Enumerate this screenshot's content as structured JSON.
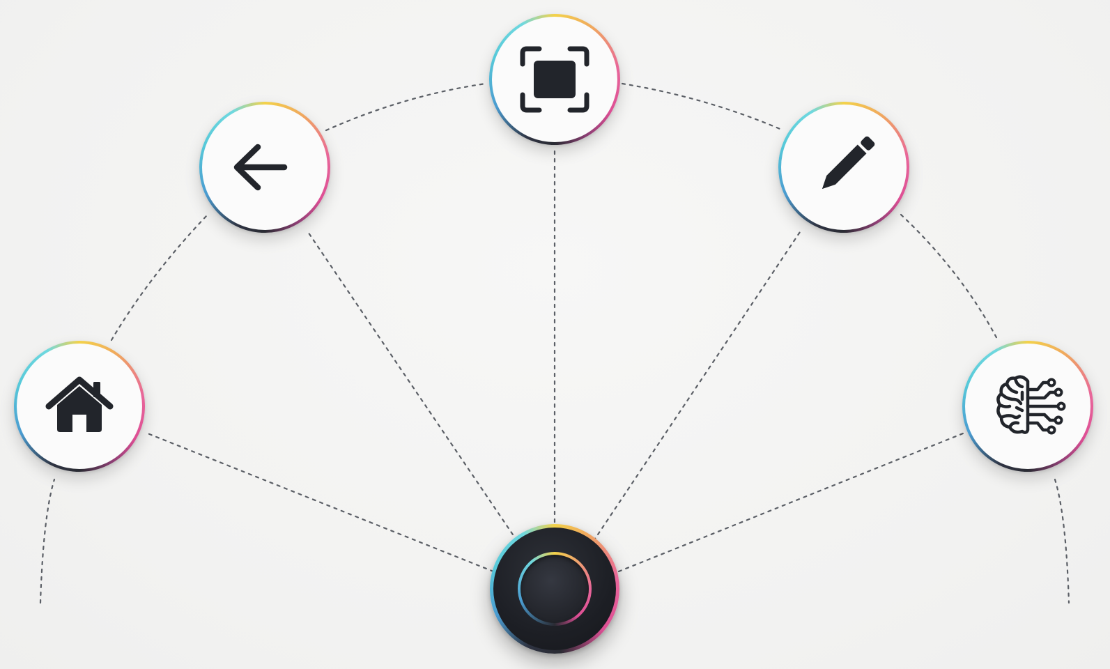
{
  "radial_menu": {
    "hub": {
      "icon": "menu-hub-knob",
      "state": "expanded"
    },
    "items": [
      {
        "id": "home",
        "icon": "home-icon"
      },
      {
        "id": "back",
        "icon": "arrow-left-icon"
      },
      {
        "id": "screenshot",
        "icon": "screenshot-frame-icon"
      },
      {
        "id": "edit",
        "icon": "pencil-icon"
      },
      {
        "id": "ai",
        "icon": "brain-circuit-icon"
      }
    ],
    "colors": {
      "background": "#f4f4f3",
      "icon": "#22252b",
      "hub": "#1d1f25",
      "ring_cyan": "#57c9d9",
      "ring_yellow": "#f3d24a",
      "ring_pink": "#dd4e94",
      "connector": "#5b5f66"
    }
  }
}
